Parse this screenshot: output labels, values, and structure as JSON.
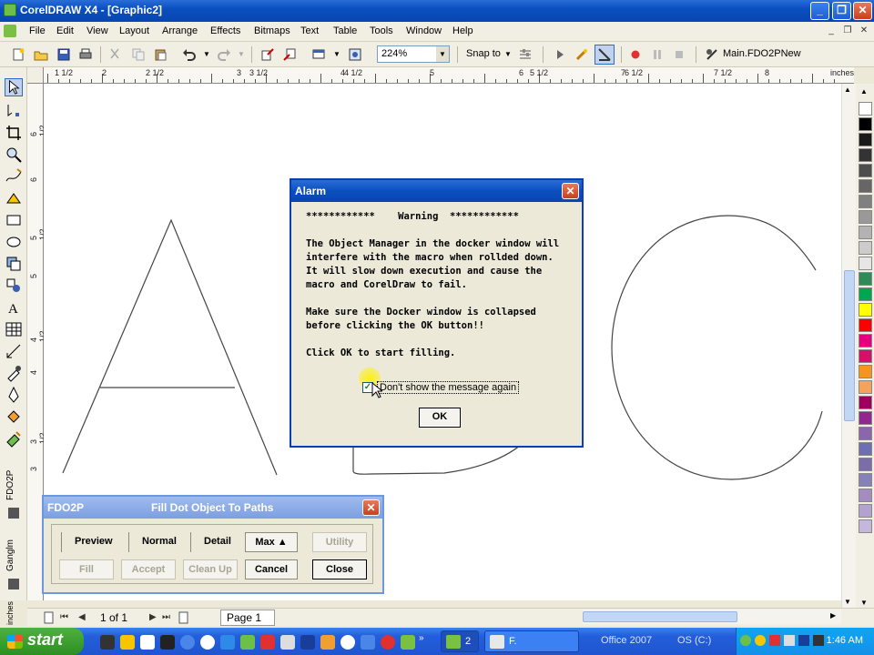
{
  "window": {
    "title": "CorelDRAW X4 - [Graphic2]"
  },
  "menu": [
    "File",
    "Edit",
    "View",
    "Layout",
    "Arrange",
    "Effects",
    "Bitmaps",
    "Text",
    "Table",
    "Tools",
    "Window",
    "Help"
  ],
  "toolbar": {
    "zoom": "224%",
    "snap_to": "Snap to",
    "macro": "Main.FDO2PNew"
  },
  "ruler": {
    "labels": [
      "1 1/2",
      "2",
      "2 1/2",
      "3",
      "3 1/2",
      "4",
      "4 1/2",
      "5",
      "5 1/2",
      "6",
      "6 1/2",
      "7",
      "7 1/2",
      "8"
    ],
    "units": "inches",
    "v_labels": [
      "6 1/2",
      "6",
      "5 1/2",
      "5",
      "4 1/2",
      "4",
      "3 1/2",
      "3"
    ]
  },
  "side_labels": {
    "fdo2p": "FDO2P",
    "ganglm": "Ganglm",
    "inches": "inches"
  },
  "pages": {
    "current": "1 of 1",
    "tab": "Page 1"
  },
  "alarm": {
    "title": "Alarm",
    "lines": [
      "************    Warning  ************",
      "",
      "The Object Manager in the docker window will",
      "interfere with the macro when rollded down.",
      "It will slow down execution and cause the",
      "macro and CorelDraw to fail.",
      "",
      "Make sure the Docker window is collapsed",
      "before clicking the OK button!!",
      "",
      "Click OK to start filling."
    ],
    "checkbox_label": "Don't show the message again",
    "checkbox_checked": true,
    "ok": "OK"
  },
  "fdo2p": {
    "name": "FDO2P",
    "title": "Fill Dot Object To Paths",
    "checks": [
      "Preview",
      "Normal",
      "Detail"
    ],
    "max": "Max",
    "utility": "Utility",
    "fill": "Fill",
    "accept": "Accept",
    "cleanup": "Clean Up",
    "cancel": "Cancel",
    "close": "Close"
  },
  "taskbar": {
    "start": "start",
    "task1_count": "2",
    "task2": "F.",
    "office": "Office 2007",
    "drive": "OS (C:)",
    "time": "1:46 AM"
  },
  "palette": [
    "#ffffff",
    "#000000",
    "#1a1a1a",
    "#333333",
    "#4d4d4d",
    "#666666",
    "#808080",
    "#999999",
    "#b3b3b3",
    "#cccccc",
    "#e6e6e6",
    "#2e8b57",
    "#00a651",
    "#ffff00",
    "#ff0000",
    "#e6007e",
    "#d60f6a",
    "#f7941d",
    "#f5a25d",
    "#9e005d",
    "#92278f",
    "#8a67ab",
    "#6d6fb4",
    "#7b6ea8",
    "#8681b9",
    "#a58cc0",
    "#b3a2cf",
    "#c5b7dc"
  ]
}
